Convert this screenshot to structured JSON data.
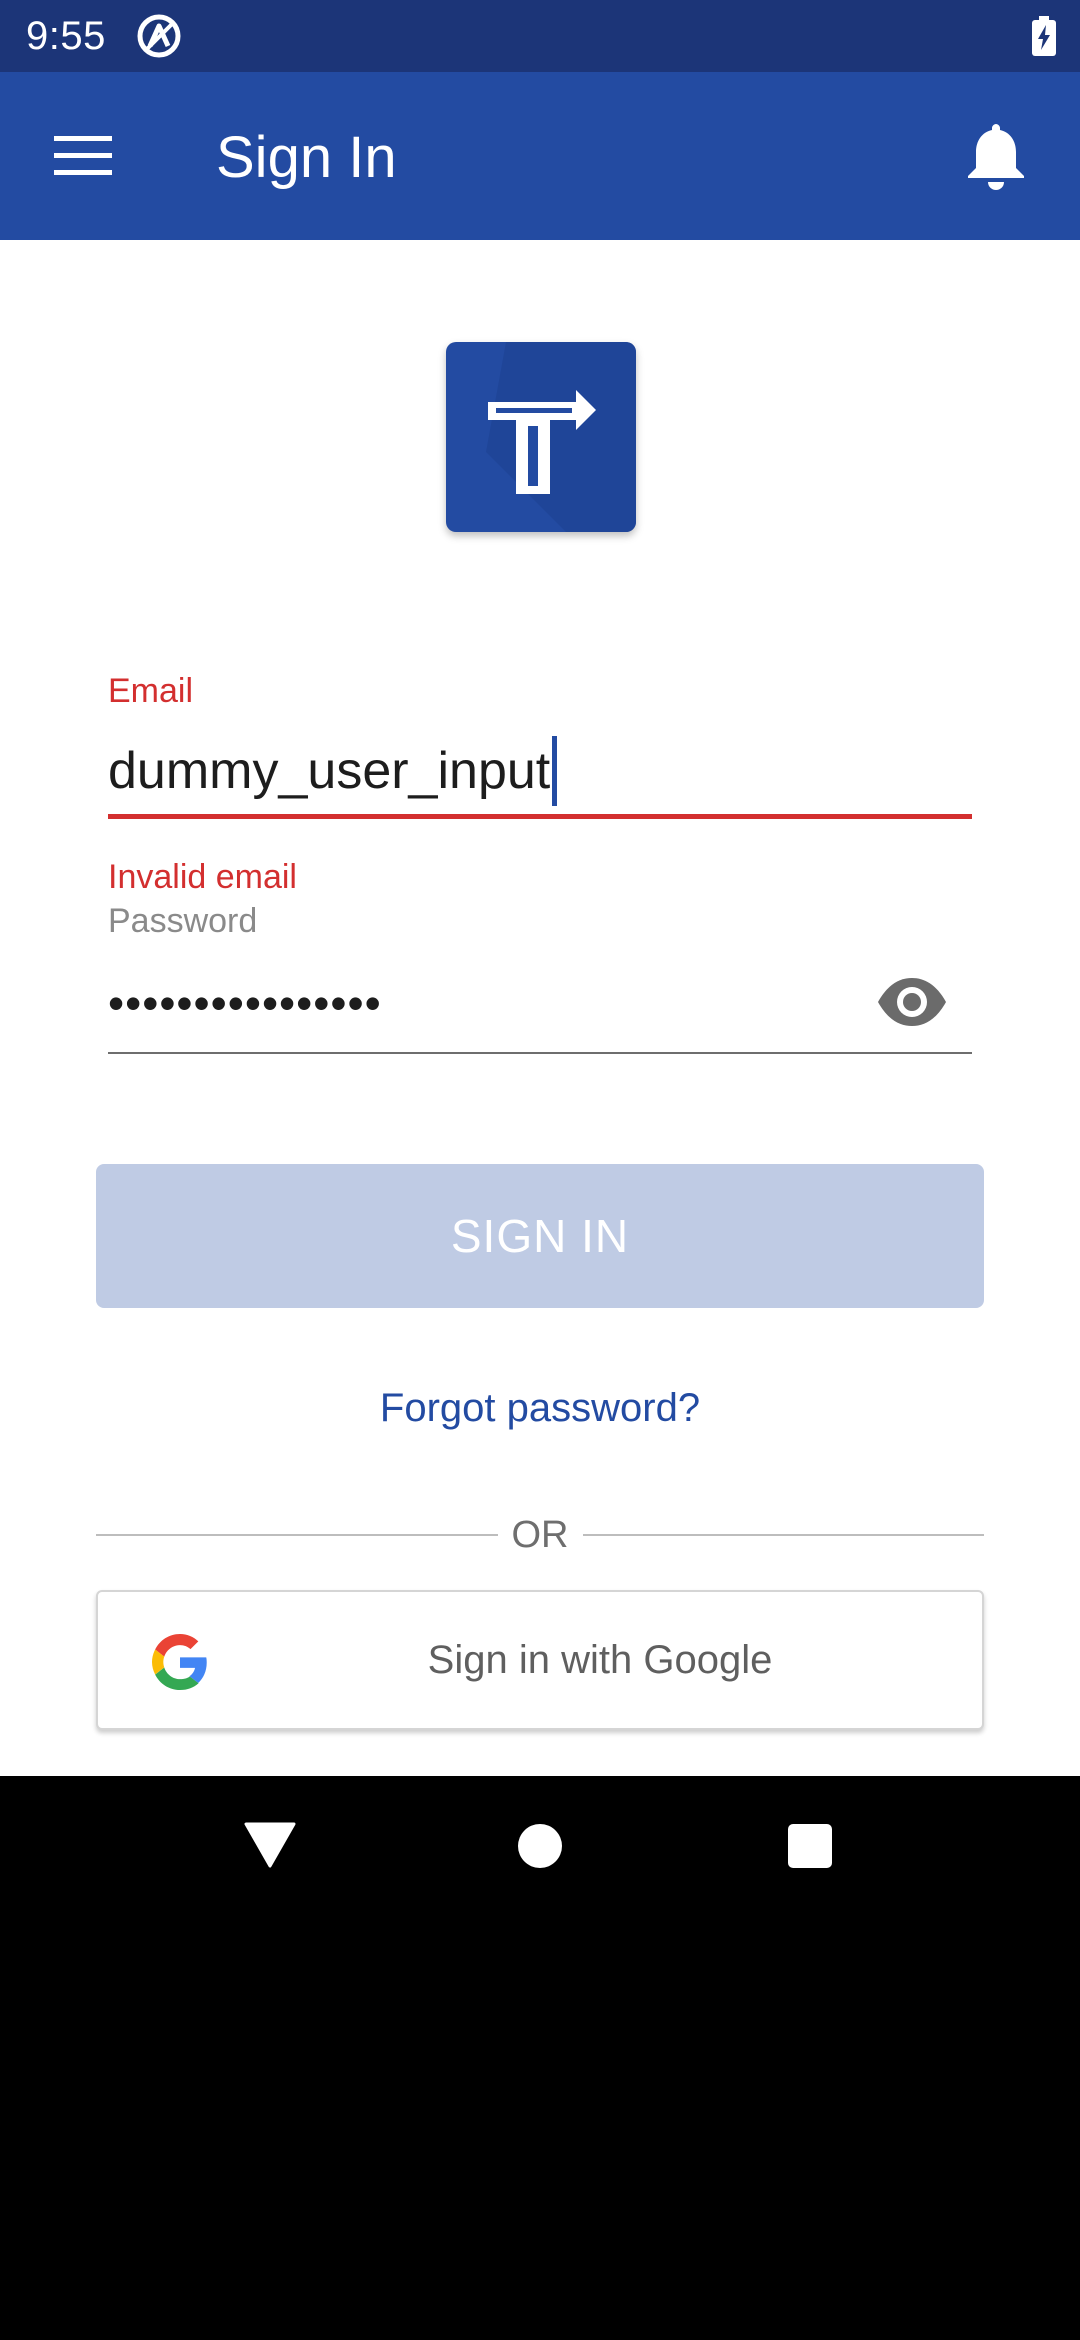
{
  "status_bar": {
    "time": "9:55",
    "app_icon": "vpn-a-icon",
    "battery_icon": "battery-charging-icon"
  },
  "app_bar": {
    "title": "Sign In",
    "menu_icon": "hamburger-menu-icon",
    "notification_icon": "bell-icon"
  },
  "logo": {
    "letter": "T",
    "icon": "app-logo-t-arrow-icon"
  },
  "form": {
    "email": {
      "label": "Email",
      "value": "dummy_user_input",
      "error": "Invalid email"
    },
    "password": {
      "label": "Password",
      "value": "••••••••••••••••",
      "toggle_icon": "eye-icon"
    },
    "signin_label": "SIGN IN",
    "forgot_label": "Forgot password?",
    "or_label": "OR",
    "google_label": "Sign in with Google"
  },
  "nav_bar": {
    "back_icon": "triangle-back-icon",
    "home_icon": "circle-home-icon",
    "recents_icon": "square-recents-icon"
  },
  "colors": {
    "primary": "#234ba2",
    "status_bar": "#1c3578",
    "error": "#d32f2f",
    "button_disabled": "#bfcbe4"
  }
}
